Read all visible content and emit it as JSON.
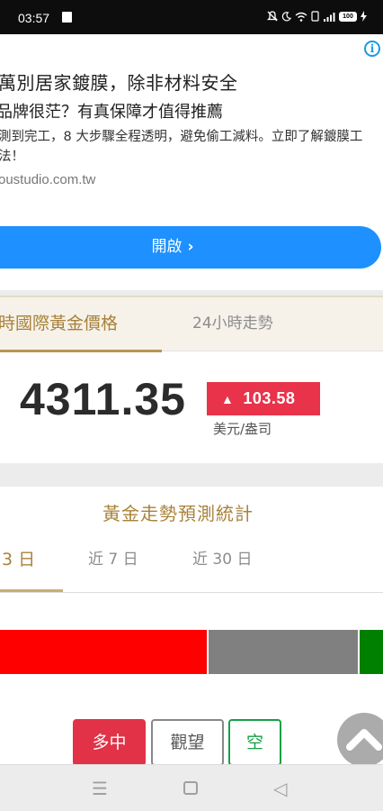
{
  "status_bar": {
    "time": "03:57",
    "battery": "100"
  },
  "ad": {
    "headline": "萬別居家鍍膜，除非材料安全",
    "subheadline": "品牌很茫？有真保障才值得推薦",
    "description": "測到完工，8 大步驟全程透明，避免偷工減料。立即了解鍍膜工法！",
    "url": "oustudio.com.tw",
    "cta_label": "開啟",
    "cta_chevron": "›"
  },
  "price_card": {
    "tabs": [
      "時國際黃金價格",
      "24小時走勢"
    ],
    "price": "4311.35",
    "change_arrow": "▲",
    "change": "103.58",
    "unit": "美元/盎司",
    "colors": {
      "up": "#e8334a",
      "accent": "#a8823a"
    }
  },
  "stats": {
    "title": "黃金走勢預測統計",
    "tabs": [
      "3 日",
      "近 7 日",
      "近 30 日"
    ],
    "bar_shares": {
      "bullish": 0.54,
      "neutral": 0.39,
      "bearish": 0.07
    },
    "bar_colors": {
      "bullish": "#ff0000",
      "neutral": "#808080",
      "bearish": "#008000"
    },
    "buttons": {
      "bullish": "多中",
      "neutral": "觀望",
      "bearish": "空"
    }
  },
  "nav_bar": {
    "menu_icon": "☰",
    "back_icon": "◁"
  }
}
